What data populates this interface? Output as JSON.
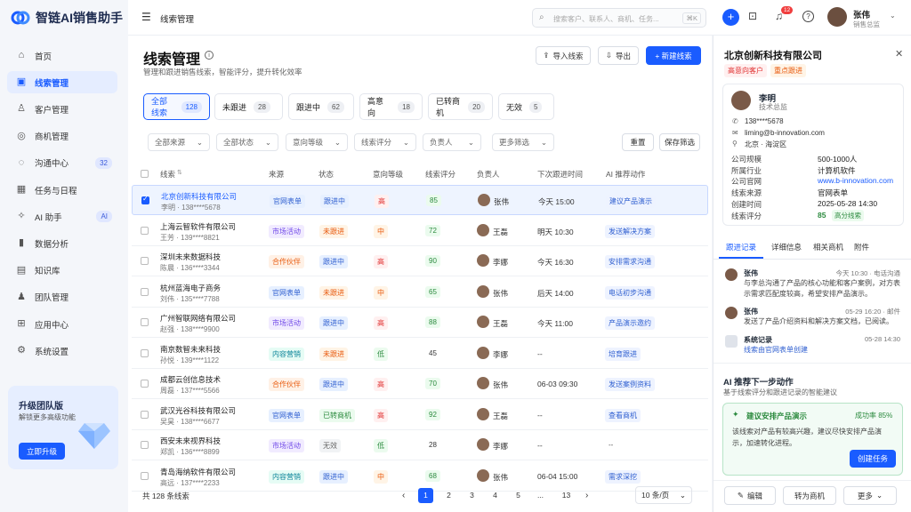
{
  "app": {
    "name": "智链AI销售助手"
  },
  "sidebar": {
    "items": [
      {
        "label": "首页",
        "icon": "home-icon",
        "glyph": "⌂"
      },
      {
        "label": "线索管理",
        "icon": "leads-icon",
        "glyph": "▣",
        "active": true
      },
      {
        "label": "客户管理",
        "icon": "customer-icon",
        "glyph": "♙"
      },
      {
        "label": "商机管理",
        "icon": "opportunity-icon",
        "glyph": "◎"
      },
      {
        "label": "沟通中心",
        "icon": "chat-icon",
        "glyph": "◌",
        "badge": "32"
      },
      {
        "label": "任务与日程",
        "icon": "calendar-icon",
        "glyph": "▦"
      },
      {
        "label": "AI 助手",
        "icon": "ai-icon",
        "glyph": "✧",
        "badge": "AI"
      },
      {
        "label": "数据分析",
        "icon": "analytics-icon",
        "glyph": "▮"
      },
      {
        "label": "知识库",
        "icon": "book-icon",
        "glyph": "▤"
      },
      {
        "label": "团队管理",
        "icon": "team-icon",
        "glyph": "♟"
      },
      {
        "label": "应用中心",
        "icon": "apps-icon",
        "glyph": "⊞"
      },
      {
        "label": "系统设置",
        "icon": "settings-icon",
        "glyph": "⚙"
      }
    ],
    "upgrade": {
      "title": "升级团队版",
      "desc": "解锁更多高级功能",
      "button": "立即升级"
    }
  },
  "topbar": {
    "section": "线索管理",
    "search_placeholder": "搜索客户、联系人、商机、任务...",
    "shortcut": "⌘K",
    "notif_count": "12",
    "user_name": "张伟",
    "user_role": "销售总监"
  },
  "page": {
    "title": "线索管理",
    "subtitle": "管理和跟进销售线索，智能评分，提升转化效率",
    "import_label": "导入线索",
    "export_label": "导出",
    "new_label": "+ 新建线索"
  },
  "tabs": [
    {
      "label": "全部线索",
      "count": "128",
      "active": true
    },
    {
      "label": "未跟进",
      "count": "28"
    },
    {
      "label": "跟进中",
      "count": "62"
    },
    {
      "label": "高意向",
      "count": "18"
    },
    {
      "label": "已转商机",
      "count": "20"
    },
    {
      "label": "无效",
      "count": "5"
    }
  ],
  "filters": [
    "全部来源",
    "全部状态",
    "意向等级",
    "线索评分",
    "负责人",
    "更多筛选"
  ],
  "filter_actions": {
    "reset": "重置",
    "save": "保存筛选"
  },
  "columns": [
    "线索",
    "来源",
    "状态",
    "意向等级",
    "线索评分",
    "负责人",
    "下次跟进时间",
    "AI 推荐动作"
  ],
  "rows": [
    {
      "company": "北京创新科技有限公司",
      "contact": "李明 · 138****5678",
      "source": "官网表单",
      "status": "跟进中",
      "intent": "高",
      "score": "85",
      "owner": "张伟",
      "next": "今天 15:00",
      "ai": "建议产品演示",
      "selected": true
    },
    {
      "company": "上海云智软件有限公司",
      "contact": "王芳 · 139****8821",
      "source": "市场活动",
      "status": "未跟进",
      "intent": "中",
      "score": "72",
      "owner": "王磊",
      "next": "明天 10:30",
      "ai": "发送解决方案"
    },
    {
      "company": "深圳未来数据科技",
      "contact": "陈晨 · 136****3344",
      "source": "合作伙伴",
      "status": "跟进中",
      "intent": "高",
      "score": "90",
      "owner": "李娜",
      "next": "今天 16:30",
      "ai": "安排需求沟通"
    },
    {
      "company": "杭州蓝海电子商务",
      "contact": "刘伟 · 135****7788",
      "source": "官网表单",
      "status": "未跟进",
      "intent": "中",
      "score": "65",
      "owner": "张伟",
      "next": "后天 14:00",
      "ai": "电话初步沟通"
    },
    {
      "company": "广州智联网络有限公司",
      "contact": "赵强 · 138****9900",
      "source": "市场活动",
      "status": "跟进中",
      "intent": "高",
      "score": "88",
      "owner": "王磊",
      "next": "今天 11:00",
      "ai": "产品演示邀约"
    },
    {
      "company": "南京数智未来科技",
      "contact": "孙悦 · 139****1122",
      "source": "内容营销",
      "status": "未跟进",
      "intent": "低",
      "score": "45",
      "owner": "李娜",
      "next": "--",
      "ai": "培育跟进"
    },
    {
      "company": "成都云创信息技术",
      "contact": "周磊 · 137****5566",
      "source": "合作伙伴",
      "status": "跟进中",
      "intent": "高",
      "score": "70",
      "owner": "张伟",
      "next": "06-03 09:30",
      "ai": "发送案例资料"
    },
    {
      "company": "武汉光谷科技有限公司",
      "contact": "吴昊 · 138****6677",
      "source": "官网表单",
      "status": "已转商机",
      "intent": "高",
      "score": "92",
      "owner": "王磊",
      "next": "--",
      "ai": "查看商机"
    },
    {
      "company": "西安未来视界科技",
      "contact": "郑凯 · 136****8899",
      "source": "市场活动",
      "status": "无效",
      "intent": "低",
      "score": "28",
      "owner": "李娜",
      "next": "--",
      "ai": "--"
    },
    {
      "company": "青岛海纳软件有限公司",
      "contact": "高远 · 137****2233",
      "source": "内容营销",
      "status": "跟进中",
      "intent": "中",
      "score": "68",
      "owner": "张伟",
      "next": "06-04 15:00",
      "ai": "需求深挖"
    }
  ],
  "pagination": {
    "total": "共 128 条线索",
    "pages": [
      "1",
      "2",
      "3",
      "4",
      "5",
      "...",
      "13"
    ],
    "per_page": "10 条/页"
  },
  "detail": {
    "company": "北京创新科技有限公司",
    "tags": [
      "高意向客户",
      "重点跟进"
    ],
    "contact_name": "李明",
    "contact_title": "技术总监",
    "phone": "138****5678",
    "email": "liming@b-innovation.com",
    "location": "北京 · 海淀区",
    "fields": [
      {
        "k": "公司规模",
        "v": "500-1000人"
      },
      {
        "k": "所属行业",
        "v": "计算机软件"
      },
      {
        "k": "公司官网",
        "v": "www.b-innovation.com",
        "link": true
      },
      {
        "k": "线索来源",
        "v": "官网表单"
      },
      {
        "k": "创建时间",
        "v": "2025-05-28 14:30"
      },
      {
        "k": "线索评分",
        "v": "85",
        "extra": "高分线索"
      }
    ],
    "tabs": [
      "跟进记录",
      "详细信息",
      "相关商机",
      "附件"
    ],
    "records": [
      {
        "who": "张伟",
        "time": "今天 10:30 · 电话沟通",
        "text": "与李总沟通了产品的核心功能和客户案例，对方表示需求匹配度较高，希望安排产品演示。"
      },
      {
        "who": "张伟",
        "time": "05-29 16:20 · 邮件",
        "text": "发送了产品介绍资料和解决方案文档，已阅读。"
      },
      {
        "who": "系统记录",
        "time": "05-28 14:30",
        "text": "线索由官网表单创建"
      }
    ],
    "ai_title": "AI 推荐下一步动作",
    "ai_sub": "基于线索评分和跟进记录的智能建议",
    "ai_card_title": "建议安排产品演示",
    "ai_rate": "成功率 85%",
    "ai_card_text": "该线索对产品有较高兴趣，建议尽快安排产品演示，加速转化进程。",
    "ai_button": "创建任务",
    "actions": [
      "编辑",
      "转为商机",
      "更多"
    ]
  },
  "colors": {
    "accent": "#1a5cff"
  }
}
